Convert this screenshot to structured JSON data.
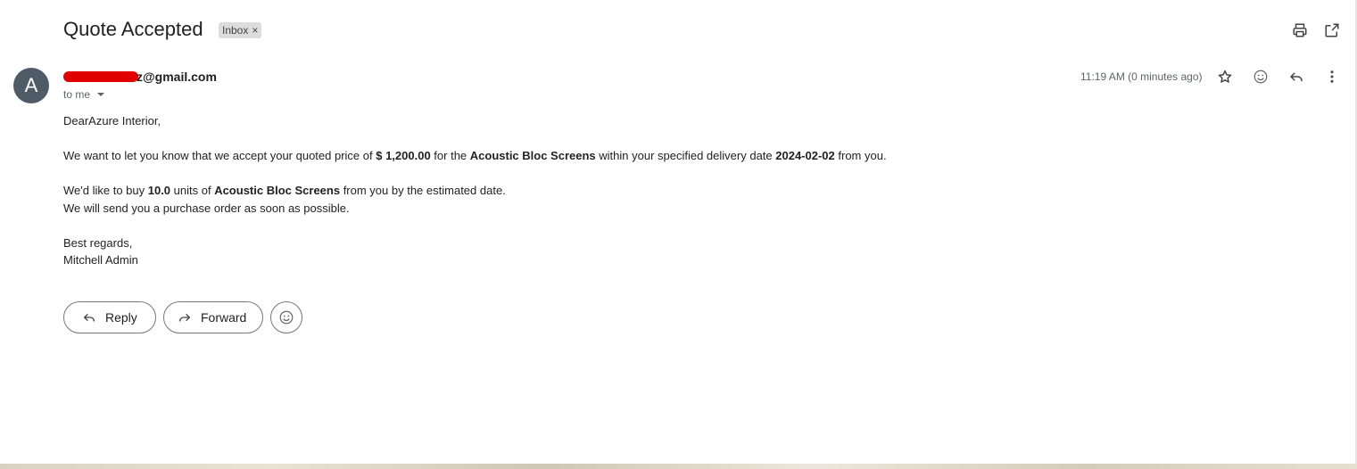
{
  "email": {
    "subject": "Quote Accepted",
    "label": "Inbox",
    "label_close": "×",
    "sender_visible": "z@gmail.com",
    "avatar_letter": "A",
    "recipient": "to me",
    "timestamp": "11:19 AM (0 minutes ago)",
    "body": {
      "greeting": "DearAzure Interior,",
      "p1_a": "We want to let you know that we accept your quoted price of ",
      "p1_price": "$ 1,200.00",
      "p1_b": " for the ",
      "p1_product": "Acoustic Bloc Screens",
      "p1_c": " within your specified delivery date ",
      "p1_date": "2024-02-02",
      "p1_d": " from you.",
      "p2_a": "We'd like to buy ",
      "p2_qty": "10.0",
      "p2_b": " units of ",
      "p2_product": "Acoustic Bloc Screens",
      "p2_c": " from you by the estimated date.",
      "p3": "We will send you a purchase order as soon as possible.",
      "closing": "Best regards,",
      "signature": "Mitchell Admin"
    }
  },
  "actions": {
    "reply_label": "Reply",
    "forward_label": "Forward"
  },
  "icons": {
    "print": "print-icon",
    "open_new_window": "open-in-new-window-icon",
    "star": "star-icon",
    "emoji": "emoji-icon",
    "reply": "reply-icon",
    "more": "more-vertical-icon"
  },
  "colors": {
    "avatar_bg": "#4f5b66",
    "label_chip_bg": "#dddddd",
    "redaction": "#e00000",
    "text_secondary": "#5f6368"
  }
}
